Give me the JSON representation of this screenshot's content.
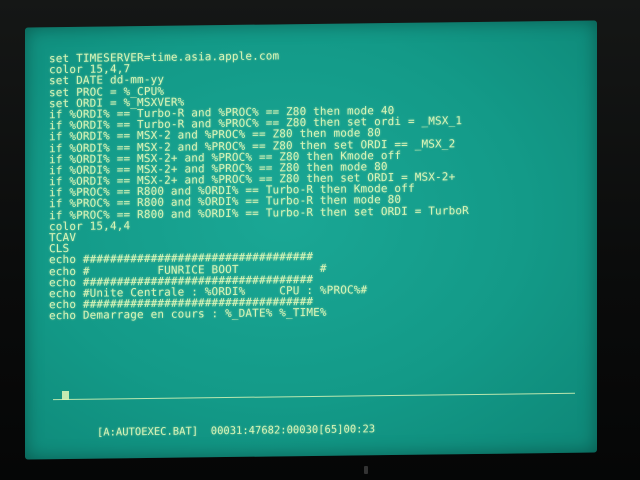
{
  "editor": {
    "lines": [
      "set TIMESERVER=time.asia.apple.com",
      "color 15,4,7",
      "set DATE dd-mm-yy",
      "set PROC = %_CPU%",
      "set ORDI = %_MSXVER%",
      "if %ORDI% == Turbo-R and %PROC% == Z80 then mode 40",
      "if %ORDI% == Turbo-R and %PROC% == Z80 then set ordi = _MSX_1",
      "if %ORDI% == MSX-2 and %PROC% == Z80 then mode 80",
      "if %ORDI% == MSX-2 and %PROC% == Z80 then set ORDI == _MSX_2",
      "if %ORDI% == MSX-2+ and %PROC% == Z80 then Kmode off",
      "if %ORDI% == MSX-2+ and %PROC% == Z80 then mode 80",
      "if %ORDI% == MSX-2+ and %PROC% == Z80 then set ORDI = MSX-2+",
      "if %PROC% == R800 and %ORDI% == Turbo-R then Kmode off",
      "if %PROC% == R800 and %ORDI% == Turbo-R then mode 80",
      "if %PROC% == R800 and %ORDI% == Turbo-R then set ORDI = TurboR",
      "color 15,4,4",
      "TCAV",
      "CLS",
      "echo ##################################",
      "echo #          FUNRICE BOOT            #",
      "echo ##################################",
      "echo #Unite Centrale : %ORDI%     CPU : %PROC%#",
      "echo ##################################",
      "echo Demarrage en cours : %_DATE% %_TIME%"
    ]
  },
  "status_bar": {
    "file": "[A:AUTOEXEC.BAT]",
    "info": "00031:47682:00030[65]00:23"
  },
  "colors": {
    "screen": "#139a88",
    "text": "#d7f4b6"
  }
}
